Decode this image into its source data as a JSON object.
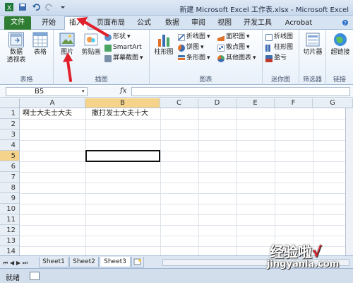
{
  "window": {
    "title": "新建 Microsoft Excel 工作表.xlsx - Microsoft Excel"
  },
  "tabs": [
    "文件",
    "开始",
    "插入",
    "页面布局",
    "公式",
    "数据",
    "审阅",
    "视图",
    "开发工具",
    "Acrobat"
  ],
  "active_tab": "插入",
  "ribbon": {
    "groups": {
      "tables": {
        "label": "表格",
        "pivot": "数据\n透视表",
        "table": "表格"
      },
      "illustrations": {
        "label": "插图",
        "picture": "图片",
        "clipart": "剪贴画",
        "shapes": "形状",
        "smartart": "SmartArt",
        "screenshot": "屏幕截图"
      },
      "charts": {
        "label": "图表",
        "column": "柱形图",
        "line": "折线图",
        "pie": "饼图",
        "bar": "条形图",
        "area": "面积图",
        "scatter": "散点图",
        "other": "其他图表"
      },
      "sparklines": {
        "label": "迷你图",
        "line": "折线图",
        "column": "柱形图",
        "winloss": "盈亏"
      },
      "filter": {
        "label": "筛选器",
        "slicer": "切片器"
      },
      "links": {
        "label": "链接",
        "hyperlink": "超链接"
      }
    }
  },
  "formula_bar": {
    "name_box": "B5",
    "fx": "fx",
    "value": ""
  },
  "grid": {
    "columns": [
      "A",
      "B",
      "C",
      "D",
      "E",
      "F",
      "G"
    ],
    "rows": [
      "1",
      "2",
      "3",
      "4",
      "5",
      "6",
      "7",
      "8",
      "9",
      "10",
      "11",
      "12",
      "13",
      "14"
    ],
    "cells": {
      "A1": "啊士大夫士大夫",
      "B1": "撒打发士大夫十大"
    },
    "active_cell": "B5"
  },
  "sheets": [
    "Sheet1",
    "Sheet2",
    "Sheet3"
  ],
  "active_sheet": "Sheet3",
  "status": {
    "text": "就绪"
  },
  "watermark": {
    "line1": "经验啦",
    "check": "√",
    "line2": "jingyanla.com"
  },
  "colors": {
    "file_tab": "#2f7d32",
    "annotation": "#e0212b",
    "selected_header": "#f5d38a"
  }
}
